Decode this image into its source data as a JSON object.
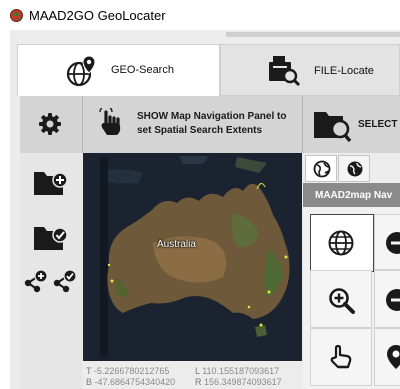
{
  "window": {
    "title": "MAAD2GO GeoLocater"
  },
  "tabs": [
    {
      "label": "GEO-Search",
      "active": true,
      "icon": "globe-pin-icon"
    },
    {
      "label": "FILE-Locate",
      "active": false,
      "icon": "file-search-icon"
    }
  ],
  "toolbar": {
    "settings_icon": "gear-icon",
    "nav_icon": "hand-pointer-icon",
    "nav_text_line1": "SHOW Map Navigation Panel to",
    "nav_text_line2": "set Spatial Search Extents",
    "select_text": "SELECT C",
    "select_icon": "folder-search-icon"
  },
  "left_panel": {
    "buttons": [
      "folder-add-icon",
      "folder-check-icon",
      "share-add-icon",
      "share-check-icon"
    ]
  },
  "map": {
    "label": "Australia",
    "coords": {
      "t_label": "T",
      "t_value": "-5.2266780212765",
      "l_label": "L",
      "l_value": "110.155187093617",
      "b_label": "B",
      "b_value": "-47.6864754340420",
      "r_label": "R",
      "r_value": "156.349874093617"
    }
  },
  "right_panel": {
    "tabs": [
      "globe-nav-icon",
      "globe-dark-icon"
    ],
    "header": "MAAD2map Nav",
    "buttons": [
      "globe-icon",
      "zoom-in-icon",
      "pan-hand-icon",
      "minus-icon",
      "minus-icon",
      "pin-icon"
    ]
  },
  "colors": {
    "map_water": "#1b2330",
    "map_land": "#6e5a3a",
    "toolbar_bg": "#d4d4d4",
    "header_bg": "#8a8a8a"
  }
}
